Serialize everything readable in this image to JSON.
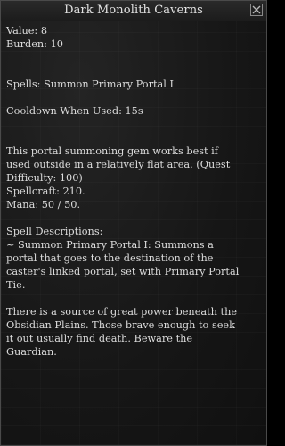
{
  "window": {
    "title": "Dark Monolith Caverns",
    "close_label": "close"
  },
  "item": {
    "value": "Value: 8",
    "burden": "Burden: 10",
    "spells": "Spells: Summon Primary Portal I",
    "cooldown": "Cooldown When Used: 15s",
    "description_line_1": "This portal summoning gem works best if",
    "description_line_2": "used outside in a relatively flat area. (Quest",
    "description_line_3": "Difficulty: 100)",
    "spellcraft": "Spellcraft: 210.",
    "mana": "Mana: 50 / 50.",
    "spell_descriptions_header": "Spell Descriptions:",
    "spell_desc_line_1": "~ Summon Primary Portal I: Summons a",
    "spell_desc_line_2": "portal that goes to the destination of the",
    "spell_desc_line_3": "caster's linked portal, set with Primary Portal",
    "spell_desc_line_4": "Tie.",
    "lore_line_1": "There is a source of great power beneath the",
    "lore_line_2": "Obsidian Plains. Those brave enough to seek",
    "lore_line_3": "it out usually find death. Beware the",
    "lore_line_4": "Guardian."
  }
}
